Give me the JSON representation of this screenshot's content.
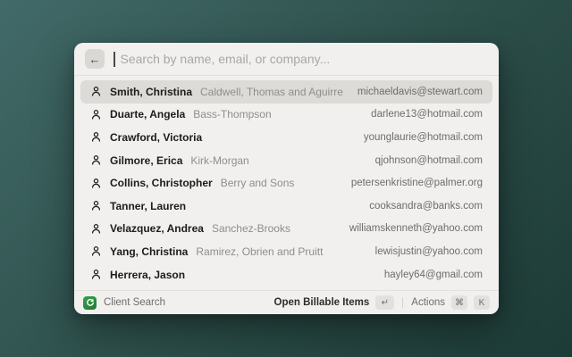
{
  "colors": {
    "background_from": "#426a68",
    "background_to": "#1d3b36",
    "window_bg": "#f1f0ee",
    "selected_row_bg": "#dcdbd8",
    "app_icon_green": "#2f9e44"
  },
  "search": {
    "placeholder": "Search by name, email, or company...",
    "back_icon": "←"
  },
  "selected_index": 0,
  "results": [
    {
      "name": "Smith, Christina",
      "company": "Caldwell, Thomas and Aguirre",
      "email": "michaeldavis@stewart.com"
    },
    {
      "name": "Duarte, Angela",
      "company": "Bass-Thompson",
      "email": "darlene13@hotmail.com"
    },
    {
      "name": "Crawford, Victoria",
      "company": "",
      "email": "younglaurie@hotmail.com"
    },
    {
      "name": "Gilmore, Erica",
      "company": "Kirk-Morgan",
      "email": "qjohnson@hotmail.com"
    },
    {
      "name": "Collins, Christopher",
      "company": "Berry and Sons",
      "email": "petersenkristine@palmer.org"
    },
    {
      "name": "Tanner, Lauren",
      "company": "",
      "email": "cooksandra@banks.com"
    },
    {
      "name": "Velazquez, Andrea",
      "company": "Sanchez-Brooks",
      "email": "williamskenneth@yahoo.com"
    },
    {
      "name": "Yang, Christina",
      "company": "Ramirez, Obrien and Pruitt",
      "email": "lewisjustin@yahoo.com"
    },
    {
      "name": "Herrera, Jason",
      "company": "",
      "email": "hayley64@gmail.com"
    }
  ],
  "footer": {
    "app_label": "Client Search",
    "primary_action": "Open Billable Items",
    "primary_key": "↵",
    "secondary_action": "Actions",
    "secondary_keys": [
      "⌘",
      "K"
    ]
  }
}
